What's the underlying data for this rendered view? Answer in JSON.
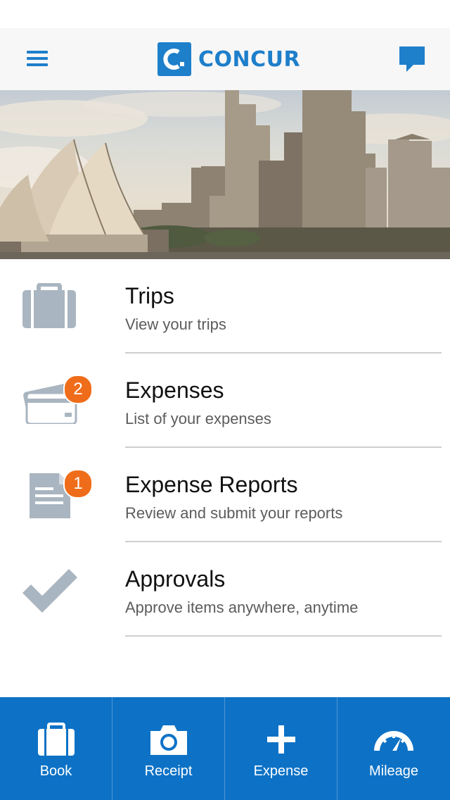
{
  "header": {
    "brand": "CONCUR",
    "logo_letter": "C."
  },
  "menu": {
    "items": [
      {
        "title": "Trips",
        "subtitle": "View your trips",
        "icon": "suitcase-icon",
        "badge": ""
      },
      {
        "title": "Expenses",
        "subtitle": "List of your expenses",
        "icon": "credit-card-icon",
        "badge": "2"
      },
      {
        "title": "Expense Reports",
        "subtitle": "Review and submit your reports",
        "icon": "report-document-icon",
        "badge": "1"
      },
      {
        "title": "Approvals",
        "subtitle": "Approve items anywhere, anytime",
        "icon": "checkmark-icon",
        "badge": ""
      }
    ]
  },
  "tabbar": {
    "items": [
      {
        "label": "Book",
        "icon": "suitcase-icon"
      },
      {
        "label": "Receipt",
        "icon": "camera-icon"
      },
      {
        "label": "Expense",
        "icon": "plus-icon"
      },
      {
        "label": "Mileage",
        "icon": "speedometer-icon"
      }
    ]
  },
  "colors": {
    "brand_blue": "#1e7fcb",
    "tabbar_blue": "#0d72c6",
    "badge_orange": "#ef6d1a",
    "icon_gray": "#a9b5c0"
  }
}
